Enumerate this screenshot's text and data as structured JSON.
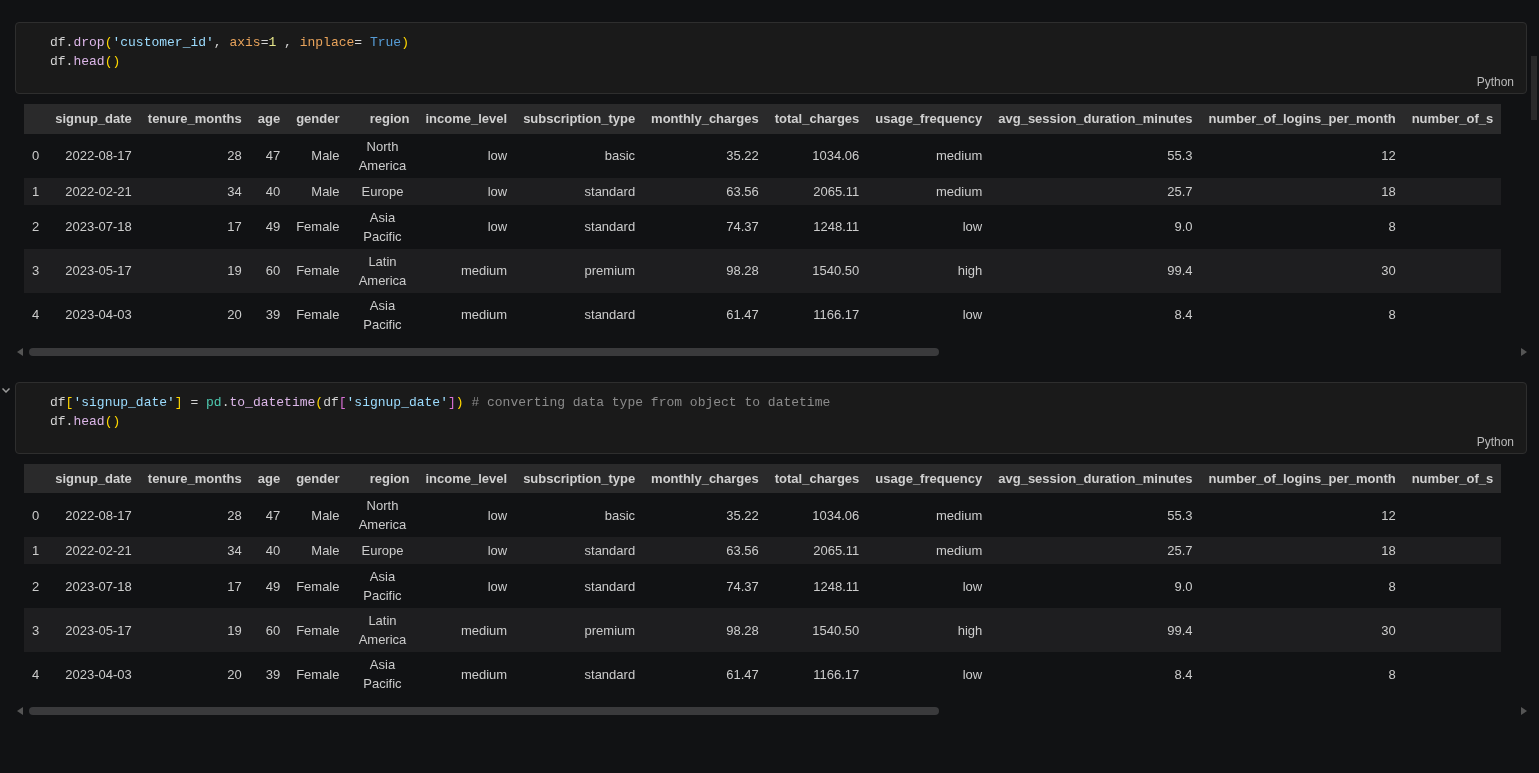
{
  "cells": [
    {
      "collapsible": false,
      "language": "Python",
      "code": [
        [
          {
            "t": "df.",
            "kind": "plain"
          },
          {
            "t": "drop",
            "kind": "func"
          },
          {
            "t": "(",
            "kind": "br1"
          },
          {
            "t": "'customer_id'",
            "kind": "str"
          },
          {
            "t": ", ",
            "kind": "plain"
          },
          {
            "t": "axis",
            "kind": "param"
          },
          {
            "t": "=",
            "kind": "plain"
          },
          {
            "t": "1",
            "kind": "num"
          },
          {
            "t": " , ",
            "kind": "plain"
          },
          {
            "t": "inplace",
            "kind": "param"
          },
          {
            "t": "= ",
            "kind": "plain"
          },
          {
            "t": "True",
            "kind": "kw"
          },
          {
            "t": ")",
            "kind": "br1"
          }
        ],
        [
          {
            "t": "df.",
            "kind": "plain"
          },
          {
            "t": "head",
            "kind": "func"
          },
          {
            "t": "()",
            "kind": "br1"
          }
        ]
      ],
      "output": {
        "columns": [
          "",
          "signup_date",
          "tenure_months",
          "age",
          "gender",
          "region",
          "income_level",
          "subscription_type",
          "monthly_charges",
          "total_charges",
          "usage_frequency",
          "avg_session_duration_minutes",
          "number_of_logins_per_month",
          "number_of_s"
        ],
        "rows": [
          [
            "0",
            "2022-08-17",
            "28",
            "47",
            "Male",
            "North America",
            "low",
            "basic",
            "35.22",
            "1034.06",
            "medium",
            "55.3",
            "12",
            ""
          ],
          [
            "1",
            "2022-02-21",
            "34",
            "40",
            "Male",
            "Europe",
            "low",
            "standard",
            "63.56",
            "2065.11",
            "medium",
            "25.7",
            "18",
            ""
          ],
          [
            "2",
            "2023-07-18",
            "17",
            "49",
            "Female",
            "Asia Pacific",
            "low",
            "standard",
            "74.37",
            "1248.11",
            "low",
            "9.0",
            "8",
            ""
          ],
          [
            "3",
            "2023-05-17",
            "19",
            "60",
            "Female",
            "Latin America",
            "medium",
            "premium",
            "98.28",
            "1540.50",
            "high",
            "99.4",
            "30",
            ""
          ],
          [
            "4",
            "2023-04-03",
            "20",
            "39",
            "Female",
            "Asia Pacific",
            "medium",
            "standard",
            "61.47",
            "1166.17",
            "low",
            "8.4",
            "8",
            ""
          ]
        ]
      }
    },
    {
      "collapsible": true,
      "language": "Python",
      "code": [
        [
          {
            "t": "df",
            "kind": "plain"
          },
          {
            "t": "[",
            "kind": "br1"
          },
          {
            "t": "'signup_date'",
            "kind": "str"
          },
          {
            "t": "]",
            "kind": "br1"
          },
          {
            "t": " = ",
            "kind": "plain"
          },
          {
            "t": "pd",
            "kind": "module"
          },
          {
            "t": ".",
            "kind": "plain"
          },
          {
            "t": "to_datetime",
            "kind": "func"
          },
          {
            "t": "(",
            "kind": "br1"
          },
          {
            "t": "df",
            "kind": "plain"
          },
          {
            "t": "[",
            "kind": "br2"
          },
          {
            "t": "'signup_date'",
            "kind": "str"
          },
          {
            "t": "]",
            "kind": "br2"
          },
          {
            "t": ")",
            "kind": "br1"
          },
          {
            "t": " # converting data type from object to datetime",
            "kind": "comment"
          }
        ],
        [
          {
            "t": "df.",
            "kind": "plain"
          },
          {
            "t": "head",
            "kind": "func"
          },
          {
            "t": "()",
            "kind": "br1"
          }
        ]
      ],
      "output": {
        "columns": [
          "",
          "signup_date",
          "tenure_months",
          "age",
          "gender",
          "region",
          "income_level",
          "subscription_type",
          "monthly_charges",
          "total_charges",
          "usage_frequency",
          "avg_session_duration_minutes",
          "number_of_logins_per_month",
          "number_of_s"
        ],
        "rows": [
          [
            "0",
            "2022-08-17",
            "28",
            "47",
            "Male",
            "North America",
            "low",
            "basic",
            "35.22",
            "1034.06",
            "medium",
            "55.3",
            "12",
            ""
          ],
          [
            "1",
            "2022-02-21",
            "34",
            "40",
            "Male",
            "Europe",
            "low",
            "standard",
            "63.56",
            "2065.11",
            "medium",
            "25.7",
            "18",
            ""
          ],
          [
            "2",
            "2023-07-18",
            "17",
            "49",
            "Female",
            "Asia Pacific",
            "low",
            "standard",
            "74.37",
            "1248.11",
            "low",
            "9.0",
            "8",
            ""
          ],
          [
            "3",
            "2023-05-17",
            "19",
            "60",
            "Female",
            "Latin America",
            "medium",
            "premium",
            "98.28",
            "1540.50",
            "high",
            "99.4",
            "30",
            ""
          ],
          [
            "4",
            "2023-04-03",
            "20",
            "39",
            "Female",
            "Asia Pacific",
            "medium",
            "standard",
            "61.47",
            "1166.17",
            "low",
            "8.4",
            "8",
            ""
          ]
        ]
      }
    }
  ]
}
